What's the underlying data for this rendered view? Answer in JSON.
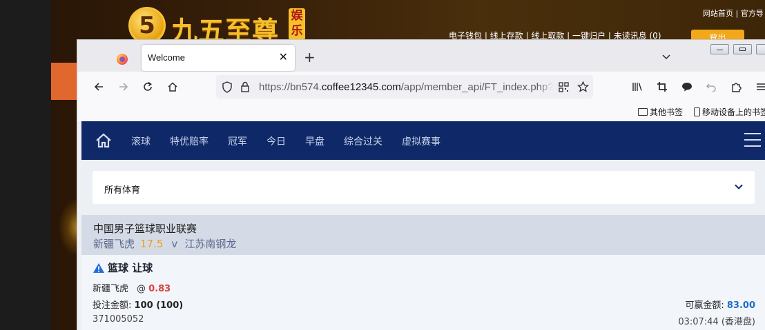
{
  "background_site": {
    "logo_glyph": "5",
    "logo_text": "九五至尊",
    "logo_badge": "娱乐",
    "top_links": "网站首页 | 官方导",
    "nav_links": "电子钱包 | 线上存款 | 线上取款 | 一键归户 | 未读讯息 (0)",
    "login_button": "登出"
  },
  "browser": {
    "tab_title": "Welcome",
    "tab_close": "✕",
    "new_tab": "+",
    "url_prefix": "https://bn574.",
    "url_domain": "coffee12345.com",
    "url_path": "/app/member_api/FT_index.php?",
    "bookmarks": [
      {
        "label": "其他书签"
      },
      {
        "label": "移动设备上的书签"
      }
    ]
  },
  "site_nav": {
    "items": [
      "滚球",
      "特优赔率",
      "冠军",
      "今日",
      "早盘",
      "综合过关",
      "虚拟赛事"
    ]
  },
  "sport_select": {
    "label": "所有体育"
  },
  "match": {
    "league": "中国男子篮球职业联赛",
    "home": "新疆飞虎",
    "handicap": "17.5",
    "vs": "v",
    "away": "江苏南钢龙"
  },
  "bet": {
    "title": "篮球 让球",
    "selection": "新疆飞虎",
    "at": "@",
    "odds": "0.83",
    "stake_label": "投注金额:",
    "stake_value": "100 (100)",
    "win_label": "可赢金额:",
    "win_value": "83.00",
    "ticket_id": "371005052",
    "time": "03:07:44 (香港盘)"
  },
  "colors": {
    "site_nav_bg": "#0f2968",
    "handicap": "#f19b12",
    "odds": "#d9433f",
    "win_value": "#1f6fc4"
  }
}
